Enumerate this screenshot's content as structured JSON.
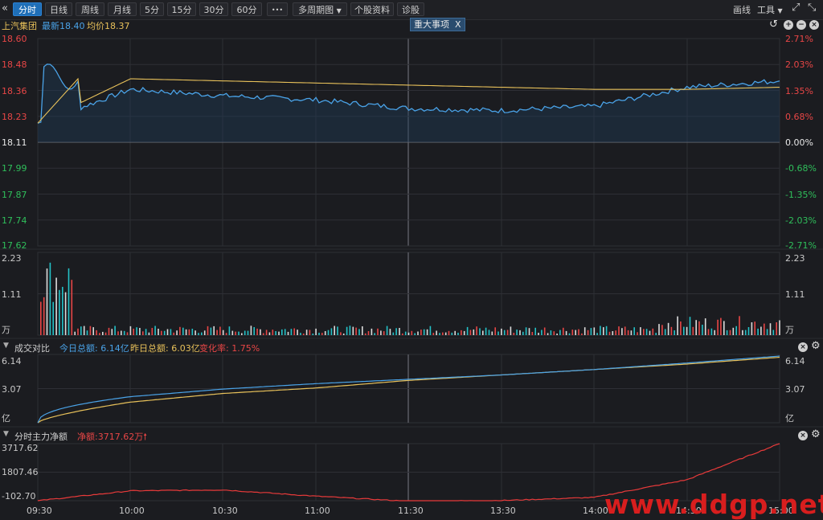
{
  "toolbar": {
    "back_icon": "«",
    "tabs": [
      "分时",
      "日线",
      "周线",
      "月线",
      "5分",
      "15分",
      "30分",
      "60分"
    ],
    "more": "•••",
    "multi_period": "多周期图",
    "profile": "个股资料",
    "diagnose": "诊股",
    "draw": "画线",
    "tools": "工具",
    "expand_icon": "expand-icon",
    "collapse_icon": "collapse-icon"
  },
  "quote": {
    "name": "上汽集团",
    "latest_label": "最新18.40",
    "avg_label": "均价18.37",
    "event_tag": "重大事项",
    "event_close": "X"
  },
  "price_axis": {
    "left": [
      "18.60",
      "18.48",
      "18.36",
      "18.23",
      "18.11",
      "17.99",
      "17.87",
      "17.74",
      "17.62"
    ],
    "right": [
      "2.71%",
      "2.03%",
      "1.35%",
      "0.68%",
      "0.00%",
      "-0.68%",
      "-1.35%",
      "-2.03%",
      "-2.71%"
    ]
  },
  "volume_axis": {
    "labels": [
      "2.23",
      "1.11",
      "万"
    ]
  },
  "compare": {
    "title": "成交对比",
    "today": "今日总额: 6.14亿",
    "yesterday": "昨日总额: 6.03亿",
    "change": "变化率: 1.75%",
    "axis": [
      "6.14",
      "3.07",
      "亿"
    ]
  },
  "mainflow": {
    "title": "分时主力净额",
    "net": "净额:3717.62万",
    "axis": [
      "3717.62",
      "1807.46",
      "-102.70"
    ]
  },
  "time_axis": [
    "09:30",
    "10:00",
    "10:30",
    "11:00",
    "11:30",
    "13:30",
    "14:00",
    "14:30",
    "15:00"
  ],
  "watermark": "www.ddgp.net",
  "colors": {
    "price": "#4aa3e8",
    "avg": "#e8c15a",
    "up": "#e84646",
    "down": "#2fbf5b",
    "vol_up": "#e84646",
    "vol_down": "#24c2c8",
    "flow": "#e83a3a"
  },
  "chart_data": [
    {
      "type": "line",
      "title": "",
      "x": [
        "09:30",
        "10:00",
        "10:30",
        "11:00",
        "11:30",
        "13:30",
        "14:00",
        "14:30",
        "15:00"
      ],
      "series": [
        {
          "name": "最新",
          "values": [
            18.2,
            18.36,
            18.33,
            18.31,
            18.27,
            18.26,
            18.28,
            18.37,
            18.4
          ]
        },
        {
          "name": "均价",
          "values": [
            18.2,
            18.41,
            18.4,
            18.39,
            18.38,
            18.37,
            18.36,
            18.36,
            18.37
          ]
        }
      ],
      "ylim": [
        17.62,
        18.6
      ]
    },
    {
      "type": "line",
      "title": "成交对比",
      "x": [
        "09:30",
        "10:00",
        "10:30",
        "11:00",
        "11:30",
        "13:30",
        "14:00",
        "14:30",
        "15:00"
      ],
      "series": [
        {
          "name": "今日总额",
          "values": [
            0.0,
            2.4,
            3.1,
            3.6,
            4.0,
            4.4,
            4.9,
            5.5,
            6.14
          ]
        },
        {
          "name": "昨日总额",
          "values": [
            0.0,
            1.9,
            2.7,
            3.2,
            3.9,
            4.4,
            4.9,
            5.4,
            6.03
          ]
        }
      ],
      "ylim": [
        0,
        6.14
      ]
    },
    {
      "type": "line",
      "title": "分时主力净额",
      "x": [
        "09:30",
        "10:00",
        "10:30",
        "11:00",
        "11:30",
        "13:30",
        "14:00",
        "14:30",
        "15:00"
      ],
      "series": [
        {
          "name": "主力净额",
          "values": [
            -102.7,
            560,
            620,
            200,
            -140,
            -90,
            120,
            1300,
            3717.62
          ]
        }
      ],
      "ylim": [
        -102.7,
        3717.62
      ]
    }
  ]
}
